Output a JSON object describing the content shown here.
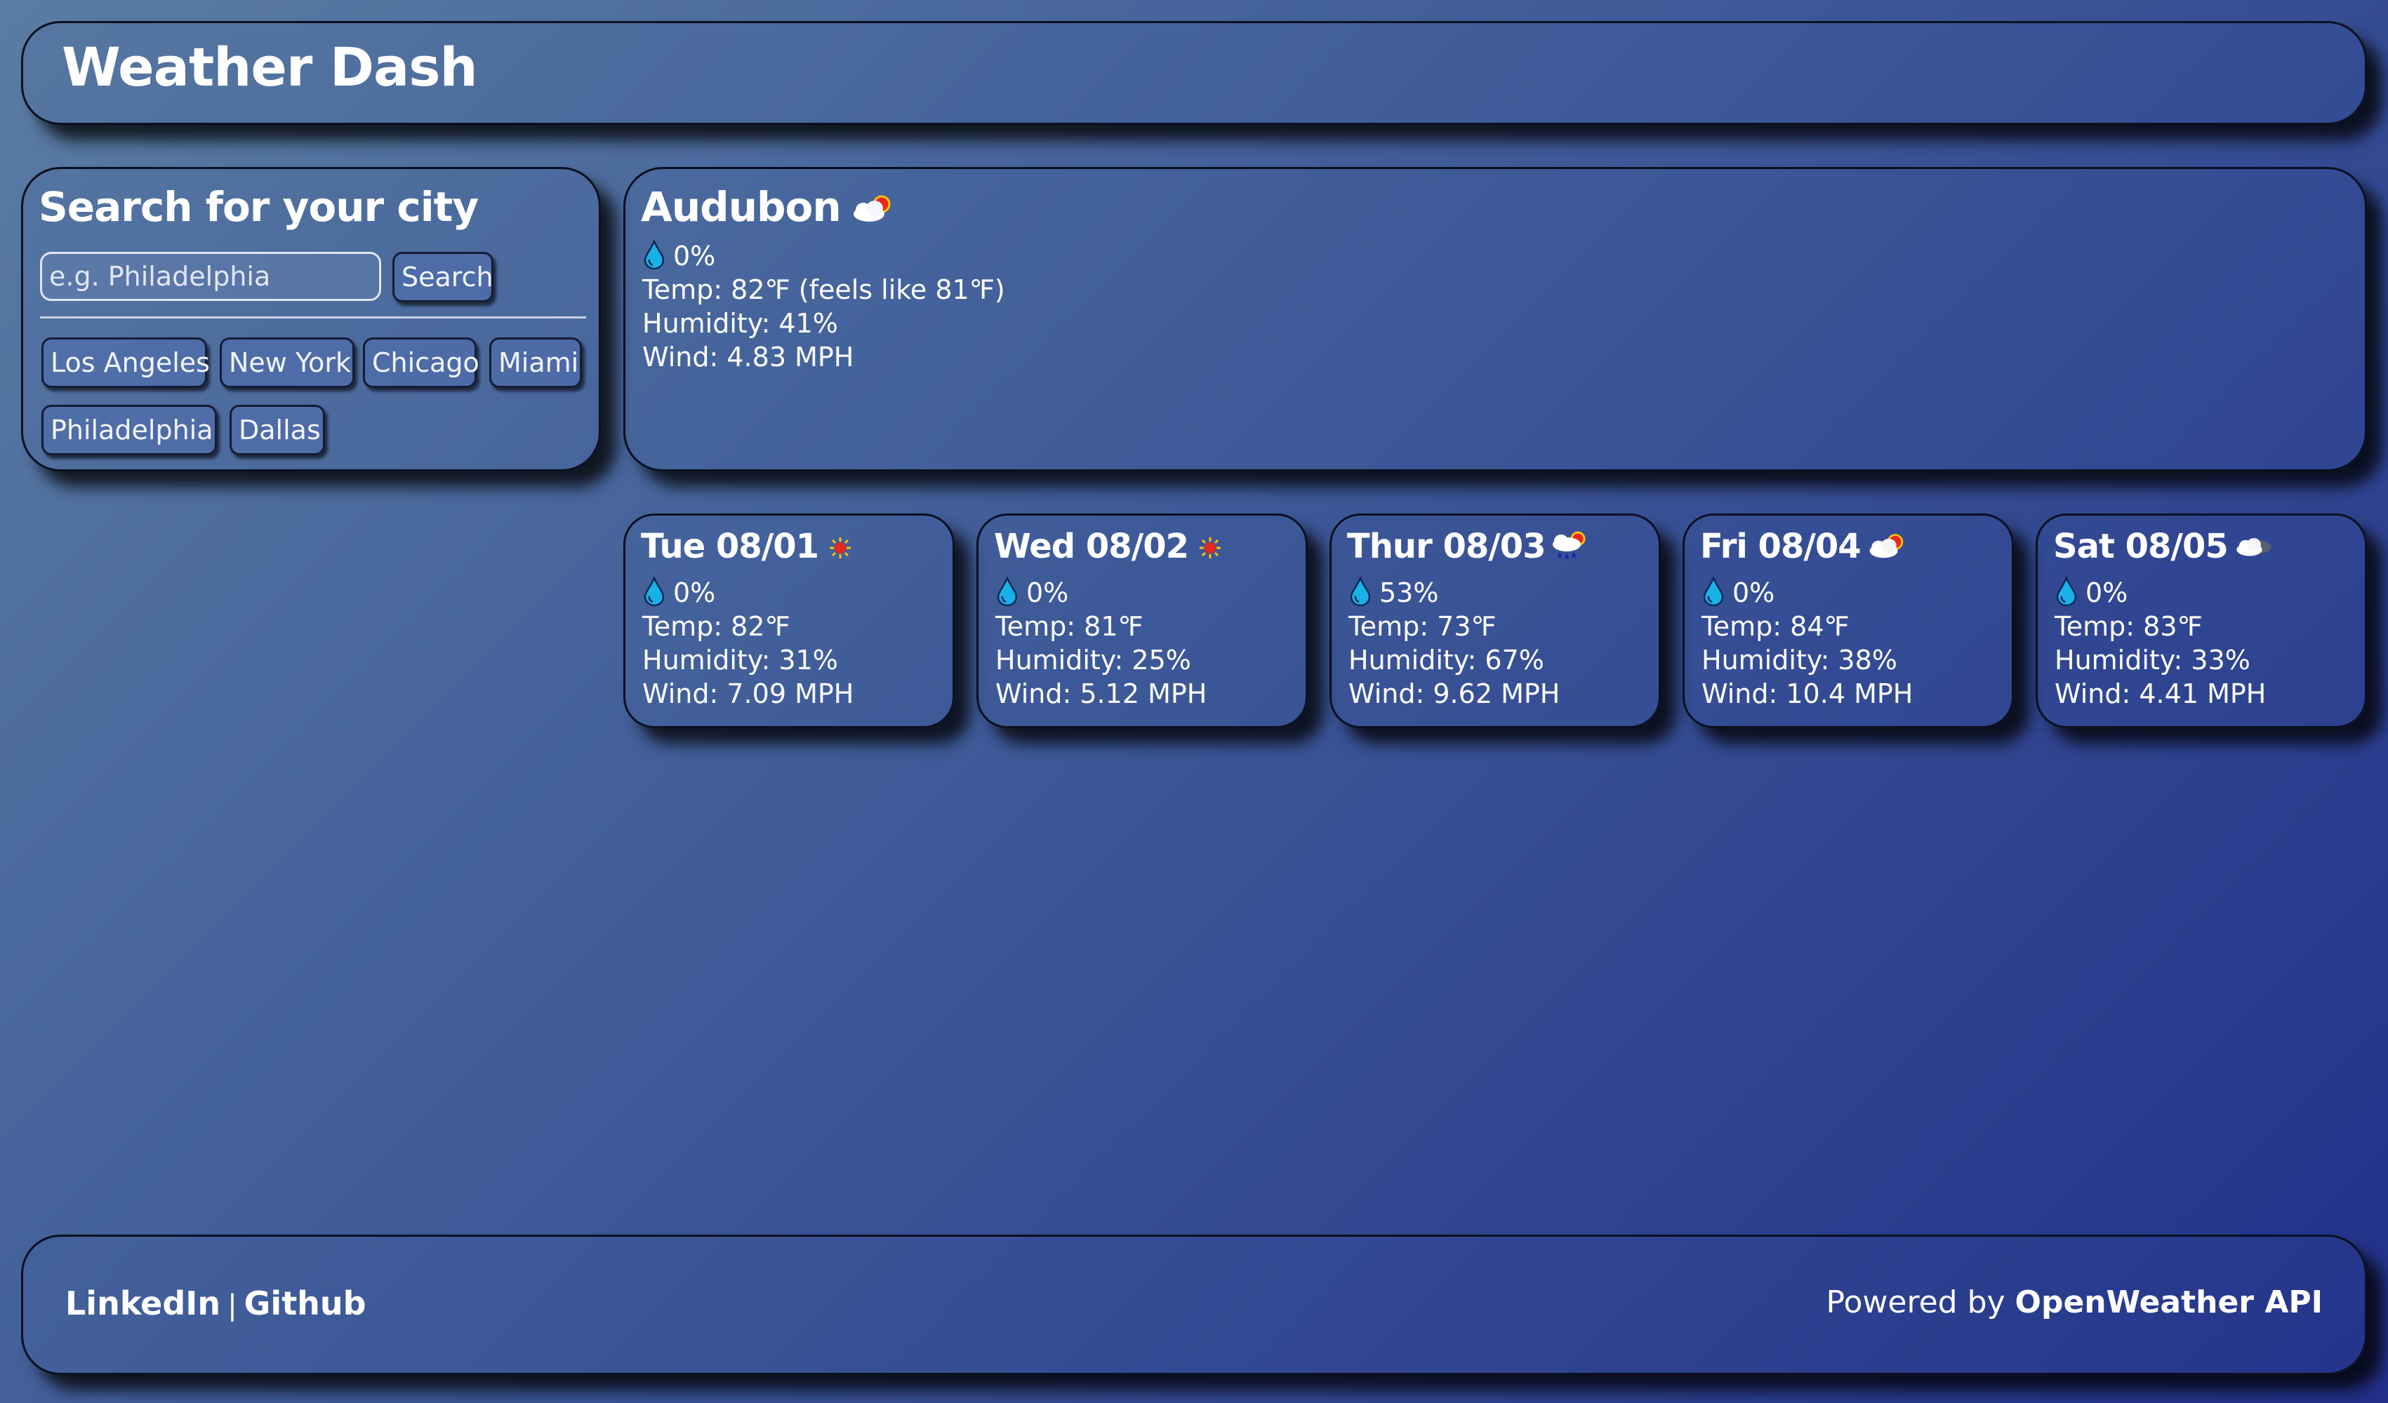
{
  "header": {
    "title": "Weather Dash"
  },
  "search": {
    "heading": "Search for your city",
    "placeholder": "e.g. Philadelphia",
    "button_label": "Search",
    "cities": [
      "Los Angeles",
      "New York",
      "Chicago",
      "Miami",
      "Philadelphia",
      "Dallas"
    ]
  },
  "current": {
    "city": "Audubon",
    "icon": "partly-cloudy-icon",
    "precip": "0%",
    "temp": "Temp: 82℉ (feels like 81℉)",
    "humidity": "Humidity: 41%",
    "wind": "Wind: 4.83 MPH"
  },
  "forecast": [
    {
      "day": "Tue 08/01",
      "icon": "sun-icon",
      "precip": "0%",
      "temp": "Temp: 82℉",
      "humidity": "Humidity: 31%",
      "wind": "Wind: 7.09 MPH"
    },
    {
      "day": "Wed 08/02",
      "icon": "sun-icon",
      "precip": "0%",
      "temp": "Temp: 81℉",
      "humidity": "Humidity: 25%",
      "wind": "Wind: 5.12 MPH"
    },
    {
      "day": "Thur 08/03",
      "icon": "rain-sun-icon",
      "precip": "53%",
      "temp": "Temp: 73℉",
      "humidity": "Humidity: 67%",
      "wind": "Wind: 9.62 MPH"
    },
    {
      "day": "Fri 08/04",
      "icon": "partly-cloudy-icon",
      "precip": "0%",
      "temp": "Temp: 84℉",
      "humidity": "Humidity: 38%",
      "wind": "Wind: 10.4 MPH"
    },
    {
      "day": "Sat 08/05",
      "icon": "cloudy-icon",
      "precip": "0%",
      "temp": "Temp: 83℉",
      "humidity": "Humidity: 33%",
      "wind": "Wind: 4.41 MPH"
    }
  ],
  "footer": {
    "linkedin": "LinkedIn",
    "separator": "|",
    "github": "Github",
    "powered_prefix": "Powered by",
    "powered_link": "OpenWeather API"
  },
  "colors": {
    "bg_start": "#5a7ca3",
    "bg_end": "#22308a",
    "drop": "#1ab0e8",
    "sun": "#e8281e",
    "sun_glow": "#f5c400"
  }
}
